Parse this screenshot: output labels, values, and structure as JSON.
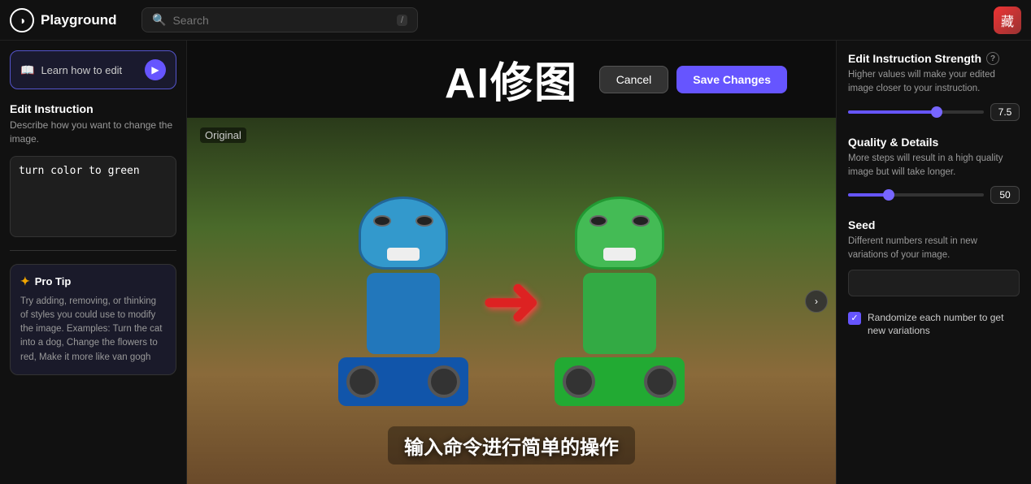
{
  "header": {
    "logo_icon": "◑",
    "logo_label": "Playground",
    "search_placeholder": "Search",
    "search_kbd": "/",
    "user_avatar": "藏"
  },
  "sidebar": {
    "learn_label": "Learn how to edit",
    "learn_icon": "▶",
    "edit_instruction_title": "Edit Instruction",
    "edit_instruction_desc": "Describe how you want to change the image.",
    "instruction_value": "turn color to green",
    "pro_tip_header": "Pro Tip",
    "pro_tip_text": "Try adding, removing, or thinking of styles you could use to modify the image. Examples: Turn the cat into a dog, Change the flowers to red, Make it more like van gogh"
  },
  "center": {
    "title": "AI修图",
    "cancel_label": "Cancel",
    "save_label": "Save Changes",
    "original_label": "Original",
    "overlay_text": "输入命令进行简单的操作",
    "expand_icon": "›"
  },
  "right_sidebar": {
    "strength_title": "Edit Instruction Strength",
    "strength_desc": "Higher values will make your edited image closer to your instruction.",
    "strength_value": "7.5",
    "strength_pct": 65,
    "quality_title": "Quality & Details",
    "quality_desc": "More steps will result in a high quality image but will take longer.",
    "quality_value": "50",
    "quality_pct": 30,
    "seed_title": "Seed",
    "seed_desc": "Different numbers result in new variations of your image.",
    "seed_placeholder": "",
    "randomize_label": "Randomize each number to get new variations",
    "randomize_checked": true,
    "info_icon": "?"
  }
}
